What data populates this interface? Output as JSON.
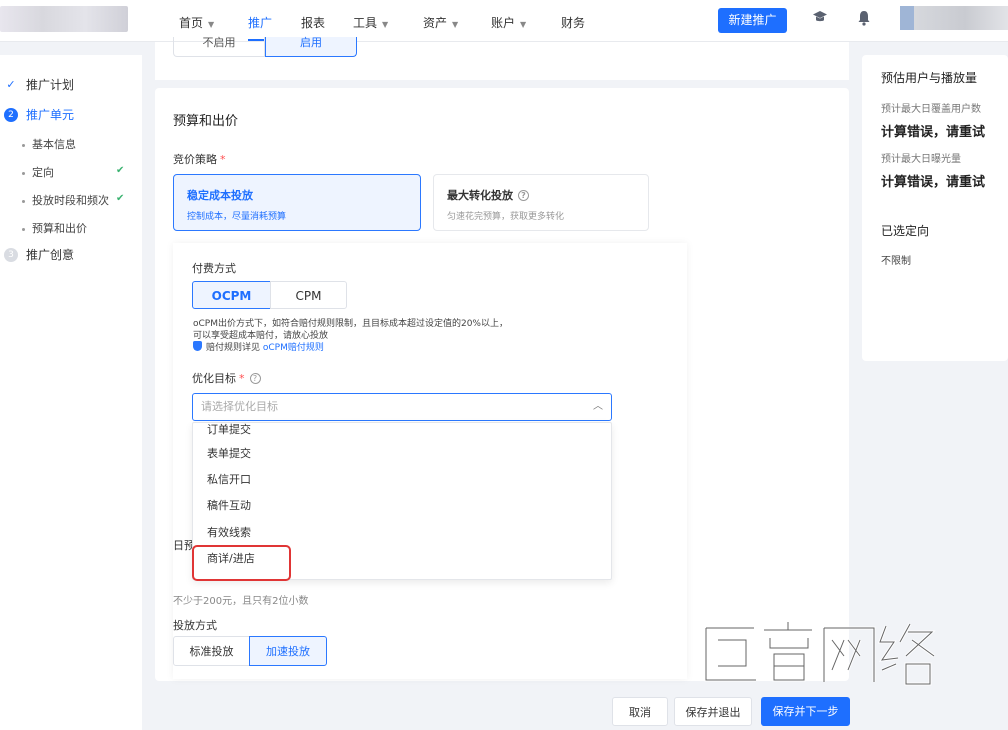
{
  "nav": {
    "items": [
      {
        "label": "首页",
        "dropdown": true
      },
      {
        "label": "推广",
        "dropdown": false,
        "active": true
      },
      {
        "label": "报表",
        "dropdown": false
      },
      {
        "label": "工具",
        "dropdown": true
      },
      {
        "label": "资产",
        "dropdown": true
      },
      {
        "label": "账户",
        "dropdown": true
      },
      {
        "label": "财务",
        "dropdown": false
      }
    ],
    "new_button": "新建推广",
    "icons": [
      "graduation-cap-icon",
      "bell-icon"
    ]
  },
  "sidebar": {
    "steps": [
      {
        "index": "✓",
        "label": "推广计划",
        "state": "done"
      },
      {
        "index": "2",
        "label": "推广单元",
        "state": "active"
      },
      {
        "index": "3",
        "label": "推广创意",
        "state": "todo"
      }
    ],
    "subs": [
      {
        "label": "基本信息",
        "done": false
      },
      {
        "label": "定向",
        "done": true
      },
      {
        "label": "投放时段和频次",
        "done": true
      },
      {
        "label": "预算和出价",
        "done": false
      }
    ]
  },
  "prev_section": {
    "toggle_off": "不启用",
    "toggle_on": "启用"
  },
  "budget": {
    "title": "预算和出价",
    "strategy_label": "竞价策略",
    "strategies": [
      {
        "title": "稳定成本投放",
        "desc": "控制成本，尽量消耗预算",
        "selected": true
      },
      {
        "title": "最大转化投放",
        "desc": "匀速花完预算，获取更多转化",
        "selected": false
      }
    ],
    "payment_label": "付费方式",
    "payments": [
      {
        "label": "OCPM",
        "selected": true
      },
      {
        "label": "CPM",
        "selected": false
      }
    ],
    "payment_desc1": "oCPM出价方式下，如符合赔付规则限制，且目标成本超过设定值的20%以上，",
    "payment_desc2": "可以享受超成本赔付，请放心投放",
    "payment_rule_prefix": "赔付规则详见",
    "payment_rule_link": "oCPM赔付规则",
    "goal_label": "优化目标",
    "goal_placeholder": "请选择优化目标",
    "goal_options": [
      "订单提交",
      "表单提交",
      "私信开口",
      "稿件互动",
      "有效线索",
      "商详/进店"
    ],
    "daily_label": "日预",
    "daily_hint": "不少于200元，且只有2位小数",
    "mode_label": "投放方式",
    "modes": [
      {
        "label": "标准投放",
        "selected": false
      },
      {
        "label": "加速投放",
        "selected": true
      }
    ]
  },
  "estimate": {
    "title": "预估用户与播放量",
    "users_label": "预计最大日覆盖用户数",
    "users_value": "计算错误，请重试",
    "views_label": "预计最大日曝光量",
    "views_value": "计算错误，请重试",
    "targeting_title": "已选定向",
    "targeting_value": "不限制"
  },
  "footer": {
    "cancel": "取消",
    "save_exit": "保存并退出",
    "save_next": "保存并下一步"
  },
  "colors": {
    "accent": "#1e6fff",
    "required": "#ff4d4f",
    "success": "#3cb371",
    "highlight": "#e03535"
  },
  "watermark": "巨宣网络"
}
